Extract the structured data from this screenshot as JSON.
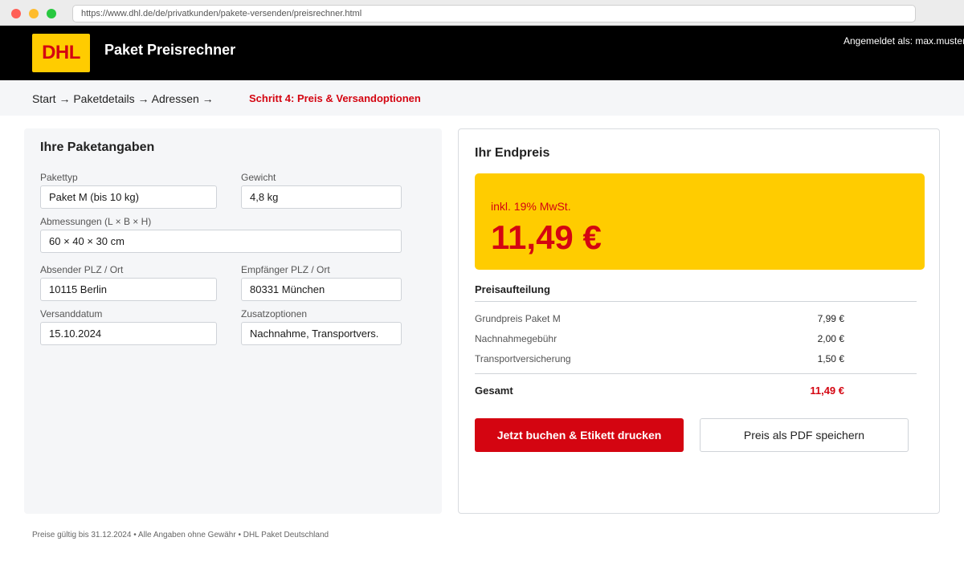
{
  "browser": {
    "url": "https://www.dhl.de/de/privatkunden/pakete-versenden/preisrechner.html"
  },
  "header": {
    "logo_text": "DHL",
    "title": "Paket Preisrechner",
    "user_label": "Angemeldet als: max.muster"
  },
  "breadcrumb": {
    "trail": "Start → Paketdetails → Adressen →",
    "current": "Schritt 4: Preis & Versandoptionen"
  },
  "package_details": {
    "title": "Ihre Paketangaben",
    "fields": [
      {
        "label": "Pakettyp",
        "value": "Paket M (bis 10 kg)"
      },
      {
        "label": "Gewicht",
        "value": "4,8 kg"
      },
      {
        "label": "Abmessungen (L × B × H)",
        "value": "60 × 40 × 30 cm"
      },
      {
        "label": "Absender PLZ / Ort",
        "value": "10115 Berlin"
      },
      {
        "label": "Empfänger PLZ / Ort",
        "value": "80331 München"
      },
      {
        "label": "Versanddatum",
        "value": "15.10.2024"
      },
      {
        "label": "Zusatzoptionen",
        "value": "Nachnahme, Transportvers."
      }
    ]
  },
  "price": {
    "title": "Ihr Endpreis",
    "vat_note": "inkl. 19% MwSt.",
    "total": "11,49 €",
    "breakdown_title": "Preisaufteilung",
    "items": [
      {
        "label": "Grundpreis Paket M",
        "value": "7,99 €"
      },
      {
        "label": "Nachnahmegebühr",
        "value": "2,00 €"
      },
      {
        "label": "Transportversicherung",
        "value": "1,50 €"
      }
    ],
    "total_label": "Gesamt",
    "total_value": "11,49 €"
  },
  "actions": {
    "book_label": "Jetzt buchen & Etikett drucken",
    "pdf_label": "Preis als PDF speichern"
  },
  "footer": {
    "text": "Preise gültig bis 31.12.2024 • Alle Angaben ohne Gewähr • DHL Paket Deutschland"
  },
  "colors": {
    "brand_yellow": "#ffcc00",
    "brand_red": "#d40511",
    "header_bg": "#000000"
  }
}
